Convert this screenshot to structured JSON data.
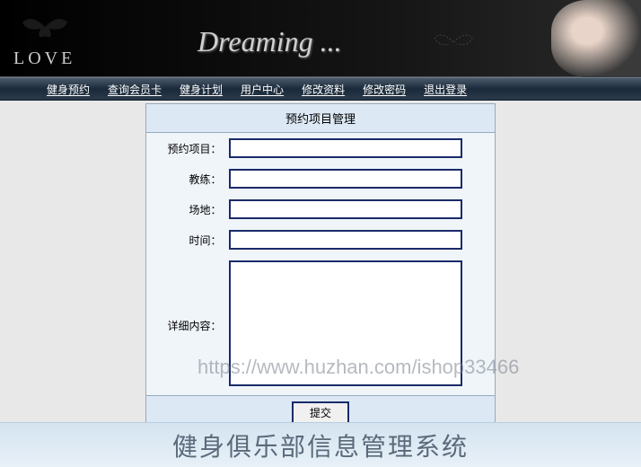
{
  "banner": {
    "love": "LOVE",
    "dreaming": "Dreaming ..."
  },
  "nav": {
    "items": [
      "健身预约",
      "查询会员卡",
      "健身计划",
      "用户中心",
      "修改资料",
      "修改密码",
      "退出登录"
    ]
  },
  "form": {
    "title": "预约项目管理",
    "labels": {
      "project": "预约项目：",
      "coach": "教练：",
      "venue": "场地：",
      "time": "时间：",
      "detail": "详细内容："
    },
    "values": {
      "project": "",
      "coach": "",
      "venue": "",
      "time": "",
      "detail": ""
    },
    "submit": "提交"
  },
  "watermark": "https://www.huzhan.com/ishop33466",
  "footer": {
    "title": "健身俱乐部信息管理系统"
  }
}
